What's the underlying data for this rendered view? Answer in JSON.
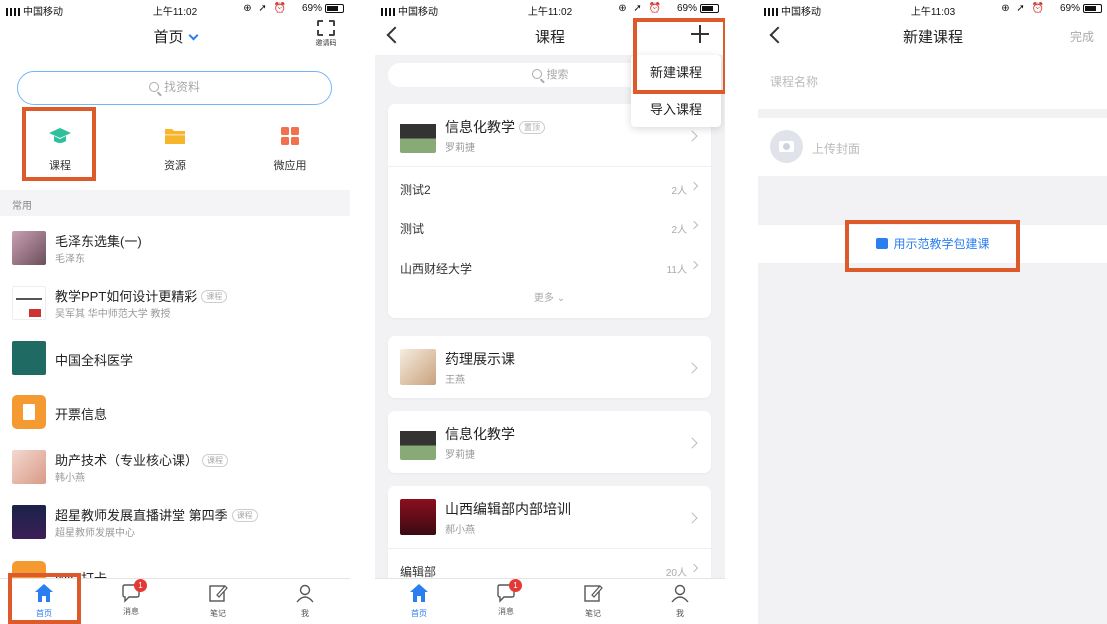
{
  "colors": {
    "accent": "#2a7ef0",
    "highlight": "#dd5a2b",
    "badge": "#e53935"
  },
  "status1": {
    "carrier": "中国移动",
    "time": "上午11:02",
    "battery": "69%"
  },
  "status2": {
    "carrier": "中国移动",
    "time": "上午11:02",
    "battery": "69%"
  },
  "status3": {
    "carrier": "中国移动",
    "time": "上午11:03",
    "battery": "69%"
  },
  "home": {
    "title": "首页",
    "scan_label": "邀请码",
    "search_placeholder": "找资料",
    "quick": [
      {
        "label": "课程",
        "icon": "graduation-cap-icon"
      },
      {
        "label": "资源",
        "icon": "folder-icon"
      },
      {
        "label": "微应用",
        "icon": "grid-apps-icon"
      }
    ],
    "section_label": "常用",
    "items": [
      {
        "title": "毛泽东选集(一)",
        "subtitle": "毛泽东",
        "tag": ""
      },
      {
        "title": "教学PPT如何设计更精彩",
        "subtitle": "吴军其 华中师范大学 教授",
        "tag": "课程"
      },
      {
        "title": "中国全科医学",
        "subtitle": "",
        "tag": ""
      },
      {
        "title": "开票信息",
        "subtitle": "",
        "tag": ""
      },
      {
        "title": "助产技术（专业核心课）",
        "subtitle": "韩小燕",
        "tag": "课程"
      },
      {
        "title": "超星教师发展直播讲堂 第四季",
        "subtitle": "超星教师发展中心",
        "tag": "课程"
      },
      {
        "title": "WiFi打卡",
        "subtitle": "",
        "tag": ""
      }
    ]
  },
  "tabbar": [
    {
      "label": "首页",
      "icon": "home-icon"
    },
    {
      "label": "消息",
      "icon": "chat-bubble-icon",
      "badge": "1"
    },
    {
      "label": "笔记",
      "icon": "note-edit-icon"
    },
    {
      "label": "我",
      "icon": "user-icon"
    }
  ],
  "courses": {
    "title": "课程",
    "search_placeholder": "搜索",
    "menu": [
      "新建课程",
      "导入课程"
    ],
    "card1": {
      "title": "信息化教学",
      "tag": "置顶",
      "subtitle": "罗莉捷",
      "sub_rows": [
        {
          "label": "测试2",
          "count": "2人"
        },
        {
          "label": "测试",
          "count": "2人"
        },
        {
          "label": "山西财经大学",
          "count": "11人"
        }
      ],
      "more": "更多"
    },
    "card2": {
      "title": "药理展示课",
      "subtitle": "王燕"
    },
    "card3": {
      "title": "信息化教学",
      "subtitle": "罗莉捷"
    },
    "card4": {
      "title": "山西编辑部内部培训",
      "subtitle": "郝小燕",
      "sub_row": {
        "label": "编辑部",
        "count": "20人"
      }
    }
  },
  "new_course": {
    "title": "新建课程",
    "done": "完成",
    "name_placeholder": "课程名称",
    "cover_label": "上传封面",
    "template_link": "用示范教学包建课"
  }
}
